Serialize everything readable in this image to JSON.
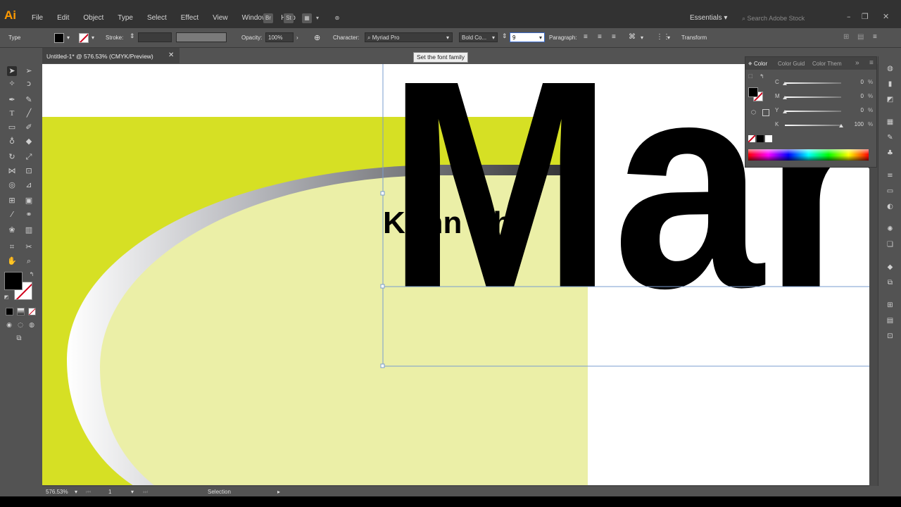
{
  "app": {
    "logo": "Ai",
    "menu": [
      "File",
      "Edit",
      "Object",
      "Type",
      "Select",
      "Effect",
      "View",
      "Window",
      "Help"
    ],
    "bridge_btn": "Br",
    "stock_btn": "St",
    "workspace": "Essentials",
    "stock_search_placeholder": "Search Adobe Stock"
  },
  "control": {
    "type_label": "Type",
    "stroke_label": "Stroke:",
    "opacity_label": "Opacity:",
    "opacity_value": "100%",
    "character_label": "Character:",
    "font_family": "Myriad Pro",
    "font_style": "Bold Co...",
    "font_size": "9",
    "paragraph_label": "Paragraph:",
    "transform_label": "Transform",
    "tooltip": "Set the font family"
  },
  "document": {
    "tab_title": "Untitled-1* @ 576.53% (CMYK/Preview)",
    "headline": "Man",
    "sub_text": "Kohn  Kho"
  },
  "color_panel": {
    "tabs": [
      "Color",
      "Color Guid",
      "Color Them"
    ],
    "sliders": [
      {
        "label": "C",
        "value": "0",
        "fraction": 0.0
      },
      {
        "label": "M",
        "value": "0",
        "fraction": 0.0
      },
      {
        "label": "Y",
        "value": "0",
        "fraction": 0.0
      },
      {
        "label": "K",
        "value": "100",
        "fraction": 1.0
      }
    ],
    "percent": "%"
  },
  "status": {
    "zoom": "576.53%",
    "artboard": "1",
    "tool_name": "Selection"
  },
  "colors": {
    "lime": "#d6e024",
    "pale_lime": "#ebefa7",
    "frame": "#7a9ccf"
  }
}
